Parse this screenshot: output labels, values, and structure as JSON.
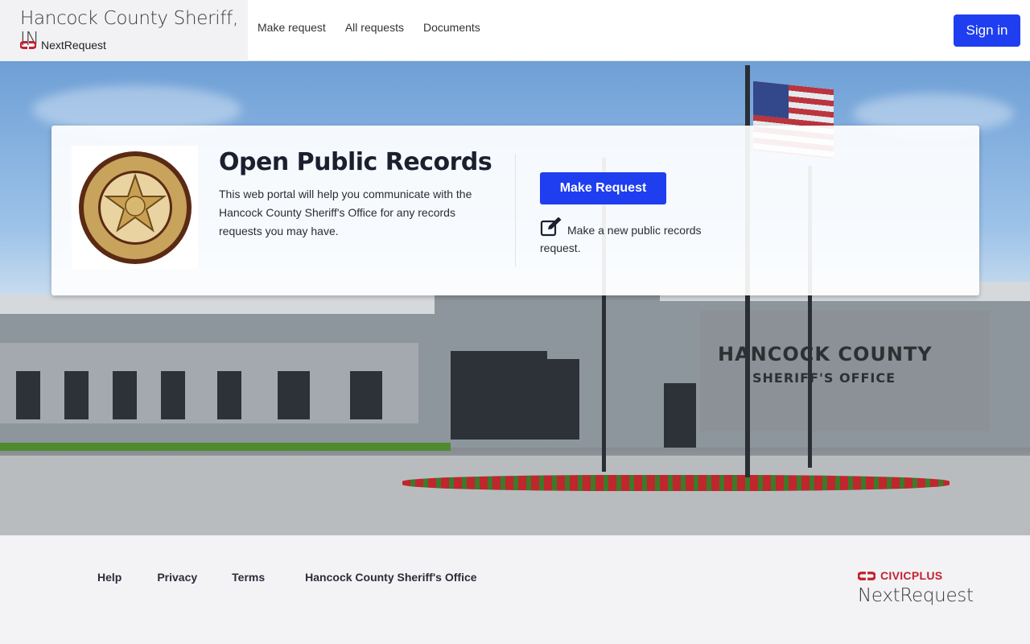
{
  "header": {
    "agency_name": "Hancock County Sheriff, IN",
    "platform_name": "NextRequest",
    "nav": [
      {
        "label": "Make request"
      },
      {
        "label": "All requests"
      },
      {
        "label": "Documents"
      }
    ],
    "sign_in_label": "Sign in",
    "accent_color": "#1f3ef0"
  },
  "hero": {
    "building_sign_line1": "HANCOCK COUNTY",
    "building_sign_line2": "SHERIFF'S OFFICE"
  },
  "card": {
    "seal_icon": "sheriff-seal-icon",
    "title": "Open Public Records",
    "description": "This web portal will help you communicate with the Hancock County Sheriff's Office for any records requests you may have.",
    "make_request_label": "Make Request",
    "make_request_hint": "Make a new public records request.",
    "edit_icon": "edit-icon"
  },
  "footer": {
    "links": [
      {
        "label": "Help"
      },
      {
        "label": "Privacy"
      },
      {
        "label": "Terms"
      },
      {
        "label": "Hancock County Sheriff's Office"
      }
    ],
    "civic_brand": "CIVICPLUS",
    "civic_product": "NextRequest",
    "civic_color": "#c4212e"
  }
}
